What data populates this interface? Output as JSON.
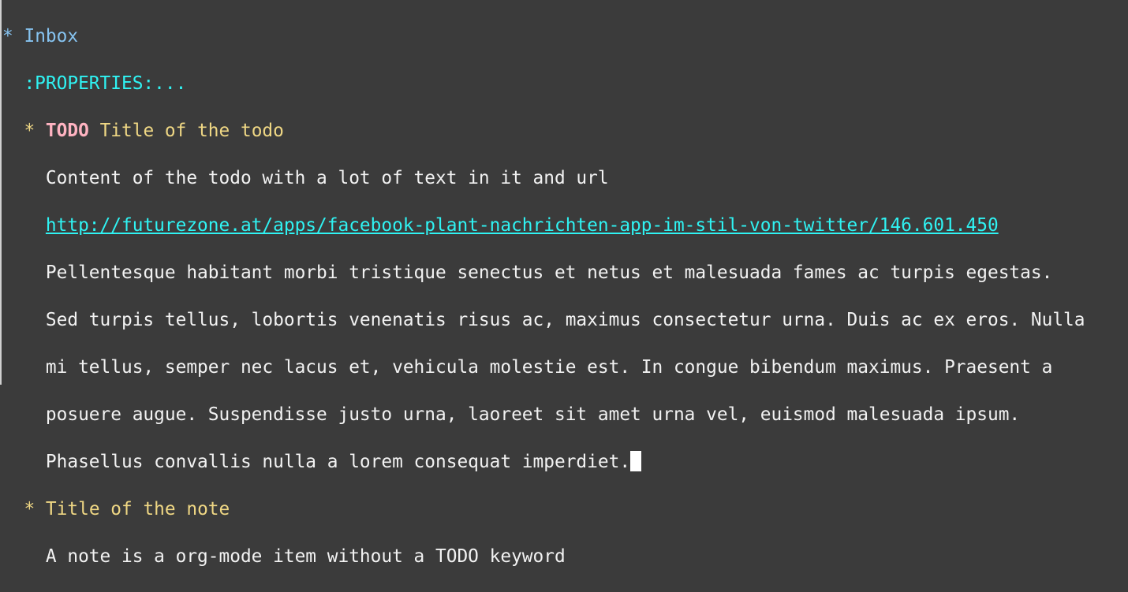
{
  "heading1": {
    "star": "*",
    "title": "Inbox"
  },
  "properties": ":PROPERTIES:...",
  "todo_item": {
    "star": "*",
    "keyword": "TODO",
    "title": "Title of the todo",
    "content_lines": [
      "Content of the todo with a lot of text in it and url"
    ],
    "url": "http://futurezone.at/apps/facebook-plant-nachrichten-app-im-stil-von-twitter/146.601.450",
    "body_lines": [
      "Pellentesque habitant morbi tristique senectus et netus et malesuada fames ac turpis egestas.",
      "Sed turpis tellus, lobortis venenatis risus ac, maximus consectetur urna. Duis ac ex eros. Nulla",
      "mi tellus, semper nec lacus et, vehicula molestie est. In congue bibendum maximus. Praesent a",
      "posuere augue. Suspendisse justo urna, laoreet sit amet urna vel, euismod malesuada ipsum.",
      "Phasellus convallis nulla a lorem consequat imperdiet."
    ]
  },
  "note_item": {
    "star": "*",
    "title": "Title of the note",
    "content": "A note is a org-mode item without a TODO keyword"
  }
}
